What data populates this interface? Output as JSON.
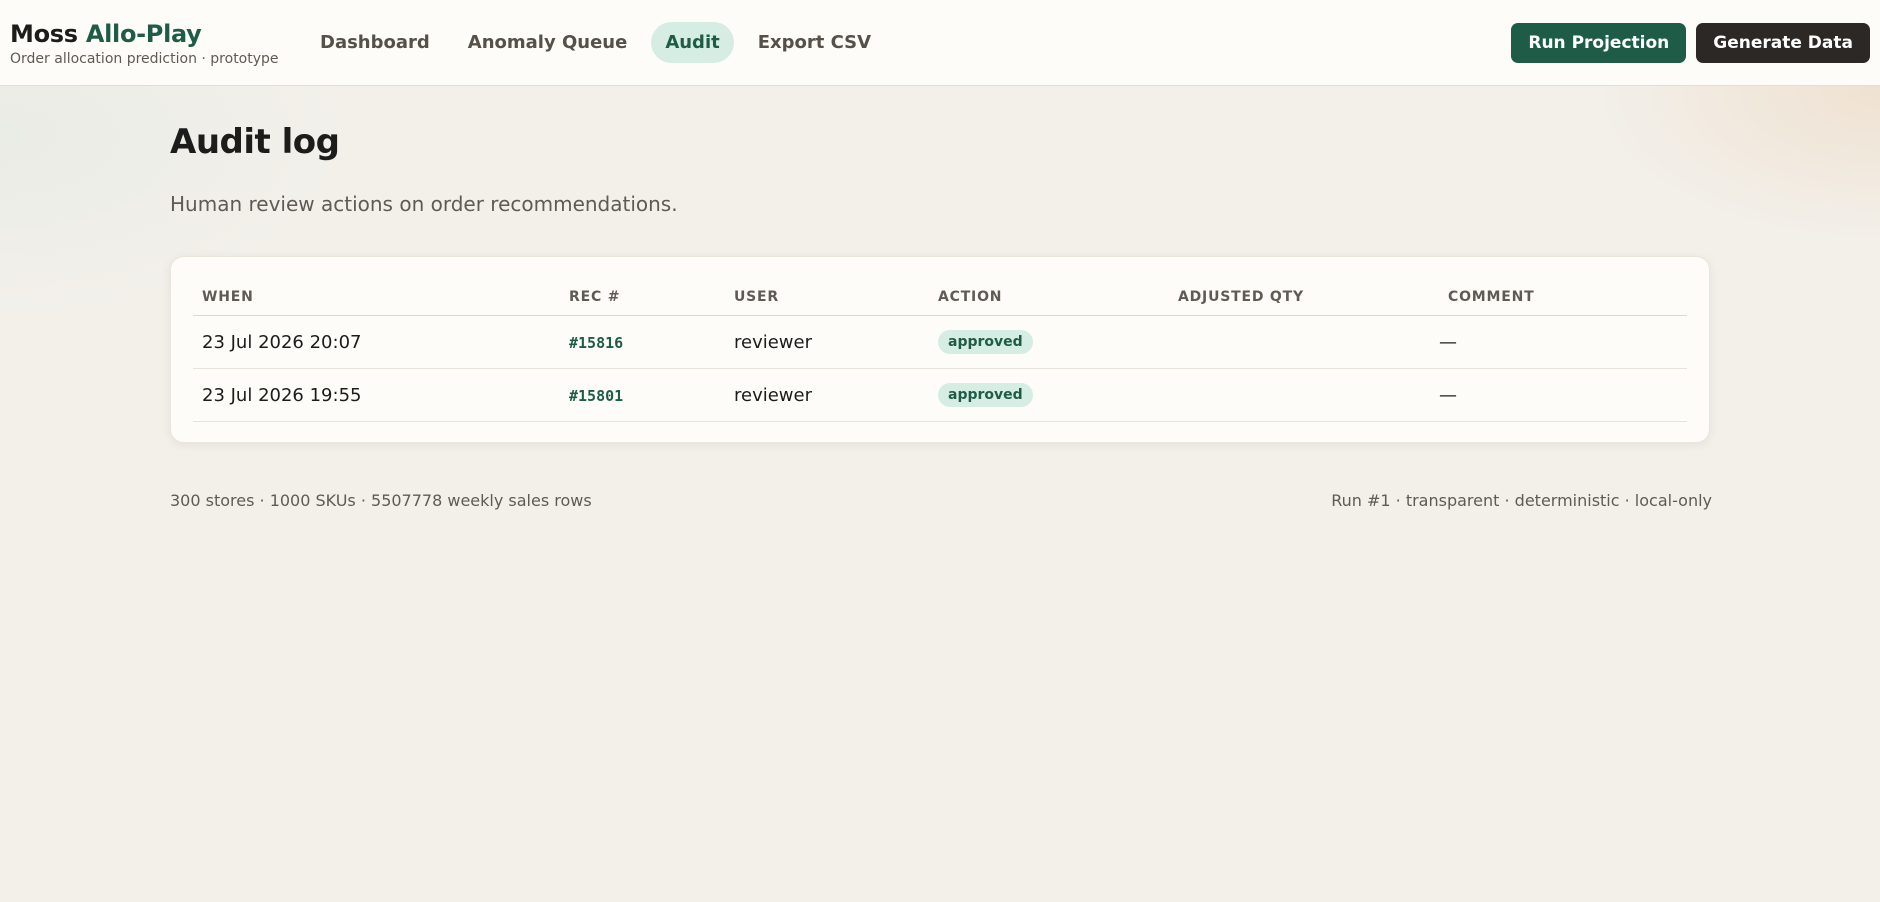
{
  "brand": {
    "name": "Moss",
    "accent": "Allo-Play",
    "subtitle": "Order allocation prediction · prototype"
  },
  "nav": [
    {
      "label": "Dashboard",
      "active": false
    },
    {
      "label": "Anomaly Queue",
      "active": false
    },
    {
      "label": "Audit",
      "active": true
    },
    {
      "label": "Export CSV",
      "active": false
    }
  ],
  "actions": {
    "run_projection": "Run Projection",
    "generate_data": "Generate Data"
  },
  "page": {
    "title": "Audit log",
    "subtitle": "Human review actions on order recommendations."
  },
  "table": {
    "columns": [
      "WHEN",
      "REC #",
      "USER",
      "ACTION",
      "ADJUSTED QTY",
      "COMMENT"
    ],
    "rows": [
      {
        "when": "23 Jul 2026 20:07",
        "rec": "#15816",
        "user": "reviewer",
        "action": "approved",
        "adjusted_qty": "",
        "comment": "—"
      },
      {
        "when": "23 Jul 2026 19:55",
        "rec": "#15801",
        "user": "reviewer",
        "action": "approved",
        "adjusted_qty": "",
        "comment": "—"
      }
    ]
  },
  "footer": {
    "left": "300 stores · 1000 SKUs · 5507778 weekly sales rows",
    "right": "Run #1 · transparent · deterministic · local-only"
  },
  "colors": {
    "accent": "#1f5c48",
    "accent_soft": "#d6ede4",
    "dark": "#2b2826",
    "background": "#f3f0ea"
  }
}
